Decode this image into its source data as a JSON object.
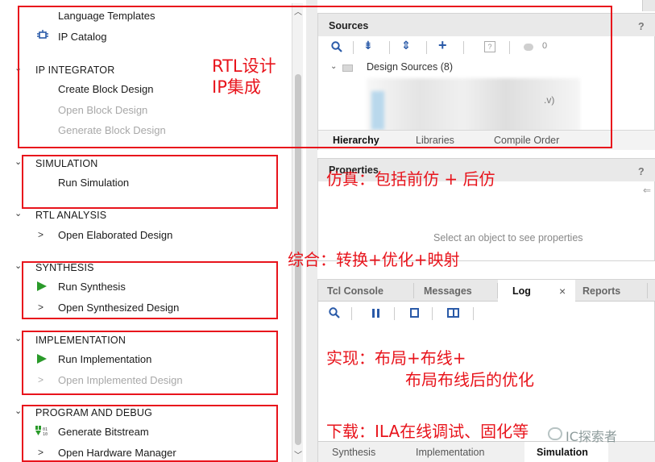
{
  "flow_navigator": {
    "top_items": [
      {
        "label": "Language Templates"
      },
      {
        "label": "IP Catalog",
        "icon": "ip-catalog-icon"
      }
    ],
    "sections": {
      "ip_integrator": {
        "title": "IP INTEGRATOR",
        "items": [
          "Create Block Design",
          "Open Block Design",
          "Generate Block Design"
        ]
      },
      "simulation": {
        "title": "SIMULATION",
        "items": [
          "Run Simulation"
        ]
      },
      "rtl_analysis": {
        "title": "RTL ANALYSIS",
        "items": [
          "Open Elaborated Design"
        ]
      },
      "synthesis": {
        "title": "SYNTHESIS",
        "items": [
          "Run Synthesis",
          "Open Synthesized Design"
        ]
      },
      "implementation": {
        "title": "IMPLEMENTATION",
        "items": [
          "Run Implementation",
          "Open Implemented Design"
        ]
      },
      "program_debug": {
        "title": "PROGRAM AND DEBUG",
        "items": [
          "Generate Bitstream",
          "Open Hardware Manager"
        ]
      }
    }
  },
  "sources_panel": {
    "title": "Sources",
    "help": "?",
    "counter": "0",
    "tree_root": "Design Sources (8)",
    "blurred_fragment": ".v)",
    "tabs": [
      "Hierarchy",
      "Libraries",
      "Compile Order"
    ],
    "active_tab": "Hierarchy"
  },
  "properties_panel": {
    "title": "Properties",
    "help": "?",
    "empty_message": "Select an object to see properties"
  },
  "console_panel": {
    "tabs": [
      "Tcl Console",
      "Messages",
      "Log",
      "Reports"
    ],
    "active_tab": "Log",
    "close": "×",
    "bottom_tabs": [
      "Synthesis",
      "Implementation",
      "Simulation"
    ],
    "active_bottom_tab": "Simulation"
  },
  "annotations": {
    "rtl_line1": "RTL设计",
    "rtl_line2": "IP集成",
    "simulation": "仿真：包括前仿 + 后仿",
    "synthesis": "综合：转换+优化+映射",
    "impl_line1": "实现：布局+布线+",
    "impl_line2": "布局布线后的优化",
    "download": "下载：ILA在线调试、固化等"
  },
  "watermark": "IC探索者",
  "colors": {
    "annotation_red": "#e8141c",
    "run_green": "#2a9a2a",
    "toolbar_blue": "#2a5aa8"
  }
}
